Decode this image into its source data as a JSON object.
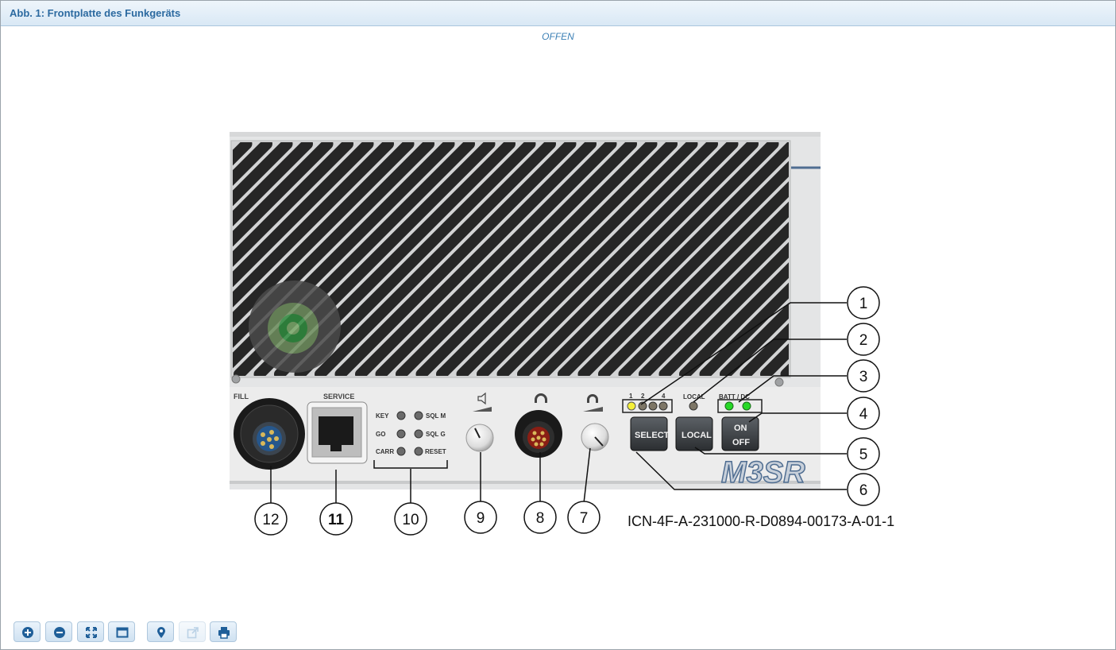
{
  "header": {
    "title": "Abb. 1: Frontplatte des Funkgeräts"
  },
  "classification": "OFFEN",
  "figure": {
    "brand": "M3SR",
    "icn": "ICN-4F-A-231000-R-D0894-00173-A-01-1",
    "panel_labels": {
      "fill": "FILL",
      "service": "SERVICE",
      "key": "KEY",
      "go": "GO",
      "carr": "CARR",
      "sql_m": "SQL M",
      "sql_g": "SQL G",
      "reset": "RESET",
      "ch1": "1",
      "ch2": "2",
      "ch4": "4",
      "local": "LOCAL",
      "batt_dc": "BATT / DC",
      "select_btn": "SELECT",
      "local_btn": "LOCAL",
      "on": "ON",
      "off": "OFF"
    },
    "callouts": [
      "1",
      "2",
      "3",
      "4",
      "5",
      "6",
      "7",
      "8",
      "9",
      "10",
      "11",
      "12"
    ]
  },
  "toolbar": {
    "buttons": [
      {
        "icon": "zoom-in-icon"
      },
      {
        "icon": "zoom-out-icon"
      },
      {
        "icon": "fit-to-window-icon"
      },
      {
        "icon": "window-icon"
      },
      {
        "icon": "location-pin-icon"
      },
      {
        "icon": "external-link-icon",
        "disabled": true
      },
      {
        "icon": "print-icon"
      }
    ]
  },
  "colors": {
    "title": "#2c6aa0",
    "accent": "#3a7fb5",
    "led_yellow": "#f5f03a",
    "led_green": "#27d827",
    "brand": "#4f6d91"
  }
}
